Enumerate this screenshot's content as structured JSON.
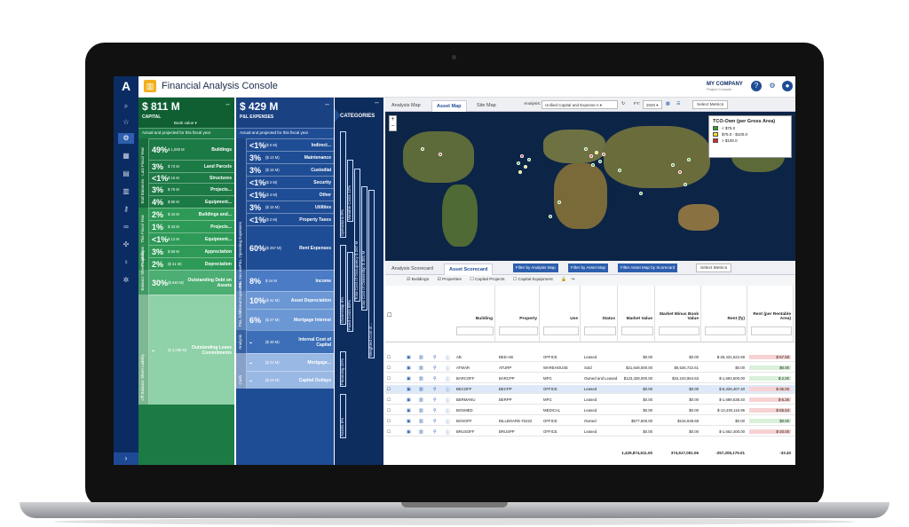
{
  "app": {
    "title": "Financial Analysis Console",
    "company": "MY COMPANY",
    "company_sub": "Project Console"
  },
  "nav": {
    "logo": "A",
    "items": [
      "search",
      "star",
      "user",
      "building",
      "chart",
      "gear",
      "key",
      "link",
      "puzzle",
      "bulb",
      "settings"
    ],
    "expand": "›"
  },
  "capital": {
    "amount": "$ 811 M",
    "title": "CAPITAL",
    "book_value": "Book value ▾",
    "note": "Actual and projected for this fiscal year",
    "sections": [
      {
        "tab": "End Balances - Last Fiscal Year",
        "rows": [
          {
            "pct": "49%",
            "amt": "$ 1,000 M",
            "label": "Buildings"
          },
          {
            "pct": "3%",
            "amt": "$ 73 M",
            "label": "Land Parcels"
          },
          {
            "pct": "<1%",
            "amt": "$ 15 M",
            "label": "Structures"
          },
          {
            "pct": "3%",
            "amt": "$ 76 M",
            "label": "Projects..."
          },
          {
            "pct": "4%",
            "amt": "$ 85 M",
            "label": "Equipment..."
          }
        ]
      },
      {
        "tab": "Projections - This Fiscal Year",
        "rows": [
          {
            "pct": "2%",
            "amt": "$ 43 M",
            "label": "Buildings and..."
          },
          {
            "pct": "1%",
            "amt": "$ 33 M",
            "label": "Projects..."
          },
          {
            "pct": "<1%",
            "amt": "$ 12 M",
            "label": "Equipment..."
          },
          {
            "pct": "3%",
            "amt": "$ 68 M",
            "label": "Appreciation"
          },
          {
            "pct": "2%",
            "amt": "($ 41 M)",
            "label": "Depreciation"
          }
        ]
      },
      {
        "tab": "Balance Sheet Liability",
        "rows": [
          {
            "pct": "30%",
            "amt": "($ 640 M)",
            "label": "Outstanding Debt on Assets"
          }
        ]
      },
      {
        "tab": "Off Balance Sheet Liability",
        "rows": [
          {
            "pct": "-",
            "amt": "($ 2,056 M)",
            "label": "Outstanding Lease Commitments"
          }
        ]
      }
    ]
  },
  "pl": {
    "amount": "$ 429 M",
    "title": "P&L EXPENSES",
    "note": "Actual and projected for this fiscal year",
    "sections": [
      {
        "tab": "P&L Operating Expenses",
        "rows": [
          {
            "pct": "<1%",
            "amt": "($ 0 M)",
            "label": "Indirect..."
          },
          {
            "pct": "3%",
            "amt": "($ 13 M)",
            "label": "Maintenance"
          },
          {
            "pct": "3%",
            "amt": "($ 15 M)",
            "label": "Custodial"
          },
          {
            "pct": "<1%",
            "amt": "($ 2 M)",
            "label": "Security"
          },
          {
            "pct": "<1%",
            "amt": "($ 4 M)",
            "label": "Other"
          },
          {
            "pct": "3%",
            "amt": "($ 15 M)",
            "label": "Utilities"
          },
          {
            "pct": "<1%",
            "amt": "($ 2 M)",
            "label": "Property Taxes"
          },
          {
            "pct": "60%",
            "amt": "($ 257 M)",
            "label": "Rent Expenses"
          }
        ]
      },
      {
        "tab": "P&L Income",
        "rows": [
          {
            "pct": "8%",
            "amt": "$ 34 M",
            "label": "Income"
          }
        ]
      },
      {
        "tab": "P&L Additional Expenses",
        "rows": [
          {
            "pct": "10%",
            "amt": "($ 41 M)",
            "label": "Asset Depreciation"
          },
          {
            "pct": "6%",
            "amt": "($ 27 M)",
            "label": "Mortgage Interest"
          }
        ]
      },
      {
        "tab": "Analysis",
        "rows": [
          {
            "pct": "-",
            "amt": "($ 49 M)",
            "label": "Internal Cost of Capital"
          }
        ]
      },
      {
        "tab": "Cash",
        "rows": [
          {
            "pct": "-",
            "amt": "($ 22 M)",
            "label": "Mortgage..."
          },
          {
            "pct": "-",
            "amt": "($ 19 M)",
            "label": "Capital Outlays"
          }
        ]
      }
    ]
  },
  "categories": {
    "title": "CATEGORIES",
    "labels": [
      "Operations 8%",
      "Variable Costs 12%",
      "Total Cost of Occupancy $ 287 M",
      "Total Cost of Ownership $ 381 M",
      "Weighted Cost of...",
      "Ownership 6%",
      "Fixed Costs 80%",
      "Financing 15%",
      "Assets 6%"
    ]
  },
  "map_tabs": [
    "Analysis Map",
    "Asset Map",
    "Site Map"
  ],
  "analysis": {
    "label": "Analysis:",
    "value": "Unified Capital and Expense A ▾",
    "fy_label": "FY:",
    "fy": "2020 ▾",
    "metrics": "Select Metrics"
  },
  "legend": {
    "title": "TCO-Own (per Gross Area)",
    "items": [
      {
        "color": "#2aa52a",
        "label": "< $75.0"
      },
      {
        "color": "#f2e21a",
        "label": "$75.0 - $100.0"
      },
      {
        "color": "#d42a2a",
        "label": "> $100.0"
      }
    ]
  },
  "score_tabs": [
    "Analysis Scorecard",
    "Asset Scorecard"
  ],
  "filters": [
    "Filter by Analysis Map",
    "Filter by Asset Map",
    "Filter Asset Map by Scorecard"
  ],
  "select_metrics": "Select Metrics",
  "checks": [
    "Buildings",
    "Properties",
    "Capital Projects",
    "Capital Equipment"
  ],
  "table": {
    "headers": [
      "Building",
      "Property",
      "Use",
      "Status",
      "Market Value",
      "Market Minus Book Value",
      "Rent (fy)",
      "Rent (per Rentable Area)"
    ],
    "rows": [
      [
        "AB",
        "BED-AB",
        "OFFICE",
        "Leased",
        "$0.00",
        "$0.00",
        "$-29,431,522.69",
        "$-57.59"
      ],
      [
        "ATWAR",
        "ATURP",
        "WAREHOUSE",
        "Sold",
        "$21,648,000.00",
        "$6,626,722.61",
        "$0.00",
        "$0.00"
      ],
      [
        "BARCOFF",
        "BARCPP",
        "MFG",
        "Owned and Leased",
        "$123,328,000.00",
        "$34,243,964.63",
        "$-1,693,600.00",
        "$-2.00"
      ],
      [
        "BECOFF",
        "BECPP",
        "OFFICE",
        "Leased",
        "$0.00",
        "$0.00",
        "$-5,325,407.40",
        "$-36.00"
      ],
      [
        "BERMANU",
        "BERPP",
        "MFG",
        "Leased",
        "$0.00",
        "$0.00",
        "$-1,689,638.40",
        "$-5.26"
      ],
      [
        "BOSMED",
        "",
        "MEDICAL",
        "Leased",
        "$0.00",
        "$0.00",
        "$-13,430,116.96",
        "$-55.63"
      ],
      [
        "BOSOFF",
        "BILLBOARD #2222",
        "OFFICE",
        "Owned",
        "$677,500.00",
        "$216,638.69",
        "$0.00",
        "$0.00"
      ],
      [
        "BRUSOFF",
        "BRUSPP",
        "OFFICE",
        "Leased",
        "$0.00",
        "$0.00",
        "$-1,662,400.00",
        "$-20.00"
      ]
    ],
    "totals": [
      "1,429,874,511.00",
      "374,517,051.06",
      "-257,205,175.01",
      "-33.40"
    ]
  }
}
